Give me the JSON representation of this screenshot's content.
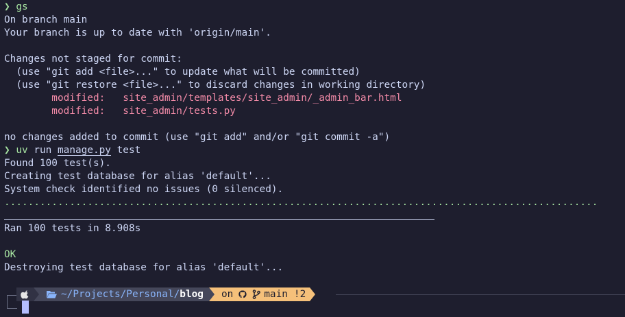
{
  "terminal": {
    "prompt_symbol": "❯",
    "cmd1": {
      "name": "gs"
    },
    "status": {
      "branch_line": "On branch main",
      "uptodate_line": "Your branch is up to date with 'origin/main'.",
      "not_staged_header": "Changes not staged for commit:",
      "hint_add": "  (use \"git add <file>...\" to update what will be committed)",
      "hint_restore": "  (use \"git restore <file>...\" to discard changes in working directory)",
      "modified": [
        {
          "label": "        modified:   ",
          "path": "site_admin/templates/site_admin/_admin_bar.html"
        },
        {
          "label": "        modified:   ",
          "path": "site_admin/tests.py"
        }
      ],
      "footer": "no changes added to commit (use \"git add\" and/or \"git commit -a\")"
    },
    "cmd2": {
      "name": "uv",
      "arg1": " run ",
      "file": "manage.py",
      "arg2": " test"
    },
    "test_output": {
      "found": "Found 100 test(s).",
      "creating": "Creating test database for alias 'default'...",
      "system_check": "System check identified no issues (0 silenced).",
      "dots": "....................................................................................................",
      "ran": "Ran 100 tests in 8.908s",
      "ok": "OK",
      "destroying": "Destroying test database for alias 'default'..."
    }
  },
  "powerline": {
    "os_icon": "apple-icon",
    "folder_icon": "folder-open-icon",
    "dir_prefix": "~/Projects/Personal/",
    "dir_current": "blog",
    "git_on": "on",
    "git_host_icon": "github-icon",
    "branch_icon": "git-branch-icon",
    "branch": "main",
    "changes": "!2",
    "colors": {
      "os_bg": "#313244",
      "dir_bg": "#45475a",
      "dir_fg": "#89b4fa",
      "git_bg": "#f5c07a"
    }
  },
  "colors": {
    "background": "#1e1e2e",
    "foreground": "#cdd6f4",
    "green": "#a6e3a1",
    "red": "#f38ba8"
  }
}
